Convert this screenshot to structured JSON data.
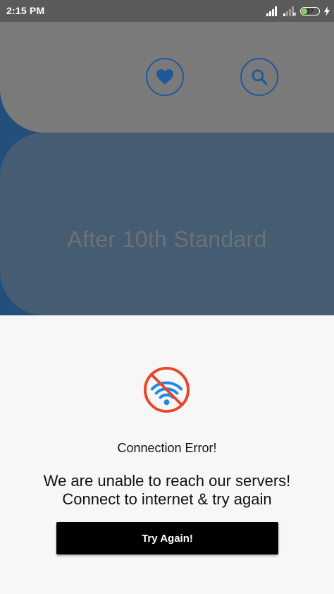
{
  "status_bar": {
    "time": "2:15 PM",
    "battery": "37",
    "battery_fraction": 0.37,
    "icons": [
      "signal-icon",
      "signal-weak-icon",
      "battery-icon",
      "charging-icon"
    ]
  },
  "header": {
    "favorites_icon": "heart-icon",
    "search_icon": "search-icon",
    "title": "After 10th Standard"
  },
  "error": {
    "icon": "wifi-off-icon",
    "title": "Connection Error!",
    "message_line1": "We are unable to reach our servers!",
    "message_line2": "Connect to internet & try again",
    "retry_label": "Try Again!"
  },
  "colors": {
    "accent_blue": "#1e5a9a",
    "wifi_blue": "#1e88e5",
    "error_red": "#e8462c",
    "button_bg": "#000000"
  }
}
